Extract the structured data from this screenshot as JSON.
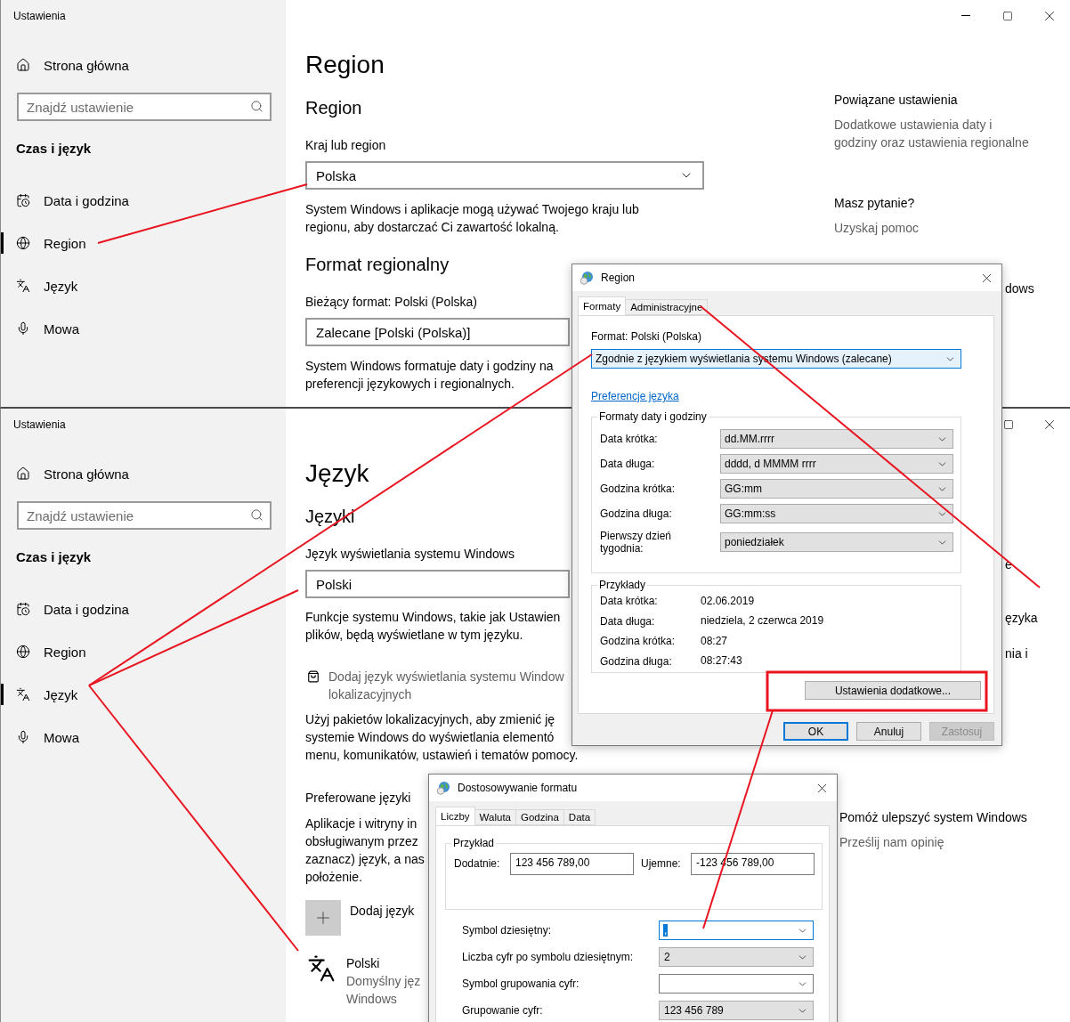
{
  "region_settings": {
    "title": "Ustawienia",
    "sidebar": {
      "home": "Strona główna",
      "search": {
        "placeholder": "Znajdź ustawienie"
      },
      "section": "Czas i język",
      "items": [
        {
          "label": "Data i godzina",
          "selected": false
        },
        {
          "label": "Region",
          "selected": true
        },
        {
          "label": "Język",
          "selected": false
        },
        {
          "label": "Mowa",
          "selected": false
        }
      ]
    },
    "page": {
      "heading": "Region",
      "subheading": "Region",
      "country_label": "Kraj lub region",
      "country_dropdown": {
        "value": "Polska"
      },
      "country_note_lines": [
        "System Windows i aplikacje mogą używać Twojego kraju lub",
        "regionu, aby dostarczać Ci zawartość lokalną."
      ],
      "format_heading": "Format regionalny",
      "format_label": "Bieżący format: Polski (Polska)",
      "format_dropdown": {
        "value": "Zalecane [Polski (Polska)]"
      },
      "format_note_lines": [
        "System Windows formatuje daty i godziny na",
        "preferencji językowych i regionalnych."
      ]
    },
    "related": {
      "heading": "Powiązane ustawienia",
      "link_lines": [
        "Dodatkowe ustawienia daty i",
        "godziny oraz ustawienia regionalne"
      ],
      "question": "Masz pytanie?",
      "help_link": "Uzyskaj pomoc",
      "fragment": "dows"
    }
  },
  "language_settings": {
    "title": "Ustawienia",
    "sidebar": {
      "home": "Strona główna",
      "search": {
        "placeholder": "Znajdź ustawienie"
      },
      "section": "Czas i język",
      "items": [
        {
          "label": "Data i godzina",
          "selected": false
        },
        {
          "label": "Region",
          "selected": false
        },
        {
          "label": "Język",
          "selected": true
        },
        {
          "label": "Mowa",
          "selected": false
        }
      ]
    },
    "page": {
      "heading": "Język",
      "subheading": "Języki",
      "display_label": "Język wyświetlania systemu Windows",
      "display_dropdown": {
        "value": "Polski"
      },
      "display_note_lines": [
        "Funkcje systemu Windows, takie jak Ustawien",
        "plików, będą wyświetlane w tym języku."
      ],
      "add_display_link_lines": [
        "Dodaj język wyświetlania systemu Window",
        "lokalizacyjnych"
      ],
      "packs_note_lines": [
        "Użyj pakietów lokalizacyjnych, aby zmienić ję",
        "systemie Windows do wyświetlania elementó",
        "menu, komunikatów, ustawień i tematów pomocy."
      ],
      "preferred_heading": "Preferowane języki",
      "preferred_note_lines": [
        "Aplikacje i witryny in",
        "obsługiwanym przez",
        "zaznacz) język, a nas",
        "położenie."
      ],
      "add_language": "Dodaj język",
      "languages": [
        {
          "name": "Polski",
          "detail_lines": [
            "Domyślny jęz",
            "Windows"
          ]
        }
      ]
    },
    "aside": {
      "fragments": [
        "e",
        "ęzyka",
        "nia i"
      ],
      "improve_link": "Pomóż ulepszyć system Windows",
      "feedback_link": "Prześlij nam opinię"
    }
  },
  "region_dialog": {
    "title": "Region",
    "tabs": [
      {
        "label": "Formaty",
        "selected": true
      },
      {
        "label": "Administracyjne",
        "selected": false
      }
    ],
    "format_label": "Format: Polski (Polska)",
    "format_combo": {
      "value": "Zgodnie z językiem wyświetlania systemu Windows (zalecane)",
      "focused": true
    },
    "link": "Preferencje języka",
    "date_group": {
      "legend": "Formaty daty i godziny",
      "rows": [
        {
          "label": "Data krótka:",
          "value": "dd.MM.rrrr"
        },
        {
          "label": "Data długa:",
          "value": "dddd, d MMMM rrrr"
        },
        {
          "label": "Godzina krótka:",
          "value": "GG:mm"
        },
        {
          "label": "Godzina długa:",
          "value": "GG:mm:ss"
        },
        {
          "label": "Pierwszy dzień tygodnia:",
          "value": "poniedziałek"
        }
      ]
    },
    "examples": {
      "legend": "Przykłady",
      "rows": [
        {
          "label": "Data krótka:",
          "value": "02.06.2019"
        },
        {
          "label": "Data długa:",
          "value": "niedziela, 2 czerwca 2019"
        },
        {
          "label": "Godzina krótka:",
          "value": "08:27"
        },
        {
          "label": "Godzina długa:",
          "value": "08:27:43"
        }
      ]
    },
    "more_button": "Ustawienia dodatkowe...",
    "buttons": [
      {
        "label": "OK",
        "default": true,
        "disabled": false
      },
      {
        "label": "Anuluj",
        "default": false,
        "disabled": false
      },
      {
        "label": "Zastosuj",
        "default": false,
        "disabled": true
      }
    ]
  },
  "format_dialog": {
    "title": "Dostosowywanie formatu",
    "tabs": [
      {
        "label": "Liczby",
        "selected": true
      },
      {
        "label": "Waluta",
        "selected": false
      },
      {
        "label": "Godzina",
        "selected": false
      },
      {
        "label": "Data",
        "selected": false
      }
    ],
    "example": {
      "legend": "Przykład",
      "positive_label": "Dodatnie:",
      "positive_value": "123 456 789,00",
      "negative_label": "Ujemne:",
      "negative_value": "-123 456 789,00"
    },
    "settings": [
      {
        "label": "Symbol dziesiętny:",
        "value": ",",
        "editable": true,
        "focused": true
      },
      {
        "label": "Liczba cyfr po symbolu dziesiętnym:",
        "value": "2",
        "editable": false,
        "focused": false
      },
      {
        "label": "Symbol grupowania cyfr:",
        "editable": true,
        "focused": false
      },
      {
        "label": "Grupowanie cyfr:",
        "value": "123 456 789",
        "editable": false,
        "focused": false
      }
    ]
  }
}
